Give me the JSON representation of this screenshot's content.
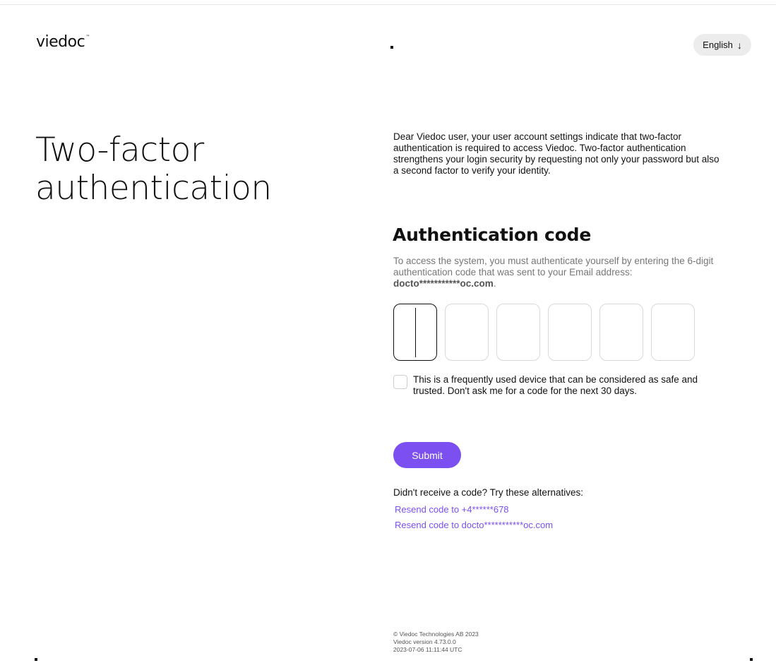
{
  "header": {
    "logo_text": "viedoc",
    "logo_tm": "™",
    "language_label": "English",
    "language_icon": "arrow-down-icon"
  },
  "main": {
    "page_title": "Two-factor authentication",
    "intro": "Dear Viedoc user, your user account settings indicate that two-factor authentication is required to access Viedoc. Two-factor authentication strengthens your login security by requesting not only your password but also a second factor to verify your identity.",
    "section_title": "Authentication code",
    "instructions_prefix": "To access the system, you must authenticate yourself by entering the 6-digit authentication code that was sent to your Email address: ",
    "email_masked": "docto***********oc.com",
    "instructions_suffix": ".",
    "code_digits": [
      "",
      "",
      "",
      "",
      "",
      ""
    ],
    "trust_device_label": "This is a frequently used device that can be considered as safe and trusted. Don't ask me for a code for the next 30 days.",
    "trust_device_checked": false,
    "submit_label": "Submit",
    "alternatives_heading": "Didn't receive a code? Try these alternatives:",
    "alternatives": [
      "Resend code to +4******678",
      "Resend code to docto***********oc.com"
    ]
  },
  "footer": {
    "copyright": "© Viedoc Technologies AB 2023",
    "version": "Viedoc  version 4.73.0.0",
    "timestamp": "2023-07-06 11:11:44 UTC"
  },
  "colors": {
    "accent": "#7b4ff0",
    "text": "#111111",
    "muted": "#777777"
  }
}
